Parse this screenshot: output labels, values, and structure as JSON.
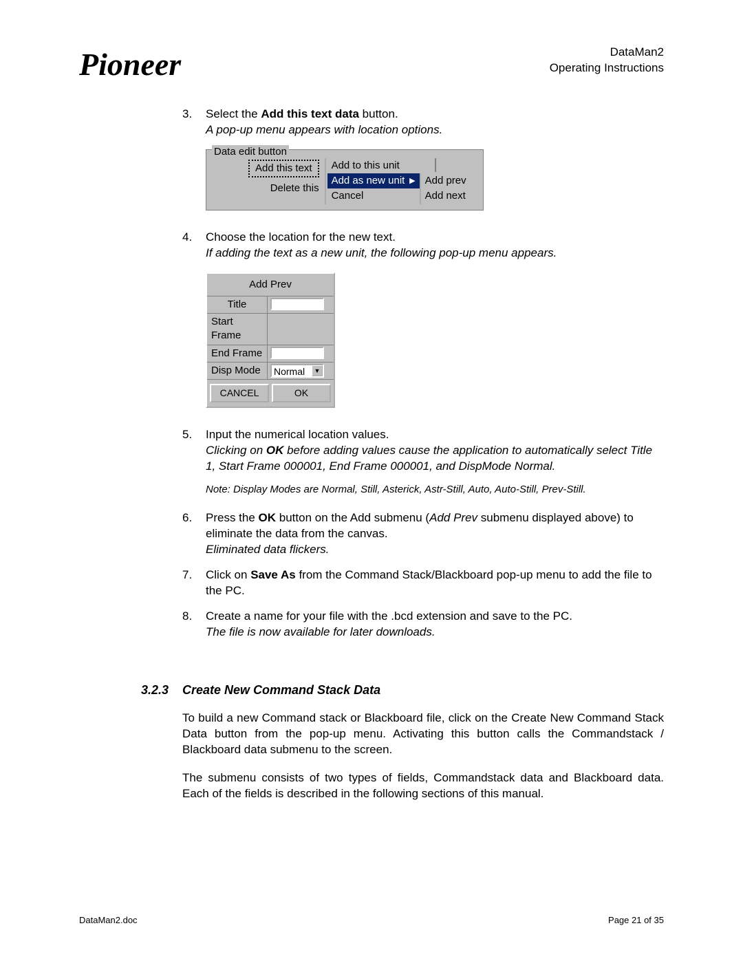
{
  "header": {
    "logo_text": "Pioneer",
    "product": "DataMan2",
    "subtitle": "Operating Instructions"
  },
  "steps": {
    "s3": {
      "num": "3.",
      "line1_a": "Select the ",
      "line1_bold": "Add this text data",
      "line1_b": " button.",
      "italic": "A pop-up menu appears with location options."
    },
    "s4": {
      "num": "4.",
      "line1": "Choose the location for the new text.",
      "italic": "If adding the text as a new unit, the following pop-up menu appears."
    },
    "s5": {
      "num": "5.",
      "line1": "Input the numerical location values.",
      "italic_a": "Clicking on ",
      "italic_bold": "OK",
      "italic_b": " before adding values cause the application to automatically select Title 1, Start Frame 000001, End Frame 000001, and DispMode Normal.",
      "note": "Note: Display Modes are Normal, Still, Asterick, Astr-Still, Auto, Auto-Still, Prev-Still."
    },
    "s6": {
      "num": "6.",
      "a": "Press the ",
      "bold": "OK",
      "b": " button on the Add submenu (",
      "ital": "Add Prev",
      "c": " submenu displayed above) to eliminate the data from the canvas.",
      "italic": "Eliminated data flickers."
    },
    "s7": {
      "num": "7.",
      "a": "Click on ",
      "bold": "Save As",
      "b": " from the Command Stack/Blackboard pop-up menu to add the file to the PC."
    },
    "s8": {
      "num": "8.",
      "line1": "Create a name for your file with the .bcd extension and save to the PC.",
      "italic": "The file is now available for later downloads."
    }
  },
  "fig1": {
    "legend": "Data edit button",
    "btn_add": "Add this text",
    "btn_del": "Delete this",
    "menu1": "Add to this unit",
    "menu2": "Add as new unit",
    "menu3": "Cancel",
    "sub1": "Add prev",
    "sub2": "Add next"
  },
  "fig2": {
    "title": "Add Prev",
    "row1": "Title",
    "row2": "Start Frame",
    "row3": "End Frame",
    "row4": "Disp Mode",
    "sel_value": "Normal",
    "cancel": "CANCEL",
    "ok": "OK"
  },
  "section": {
    "num": "3.2.3",
    "title": "Create New Command Stack Data",
    "p1_a": "To build a new Command stack or Blackboard file, click on the ",
    "p1_bold": "Create New Command Stack Data",
    "p1_b": " button from the pop-up menu.  Activating this button calls the Commandstack / Blackboard data submenu to the screen.",
    "p2": "The submenu consists of two types of fields, Commandstack data and Blackboard data.  Each of the fields is described in the following sections of this manual."
  },
  "footer": {
    "left": "DataMan2.doc",
    "right": "Page 21 of 35"
  }
}
